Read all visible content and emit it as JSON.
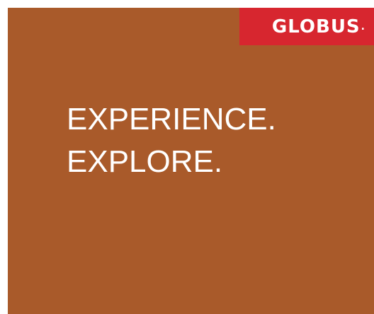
{
  "brand": {
    "name": "GLOBUS",
    "mark": ".",
    "logo_bg_color": "#d7262f"
  },
  "ad": {
    "background_color": "#a95a2a",
    "headline_lines": [
      "EXPERIENCE.",
      "EXPLORE."
    ]
  }
}
